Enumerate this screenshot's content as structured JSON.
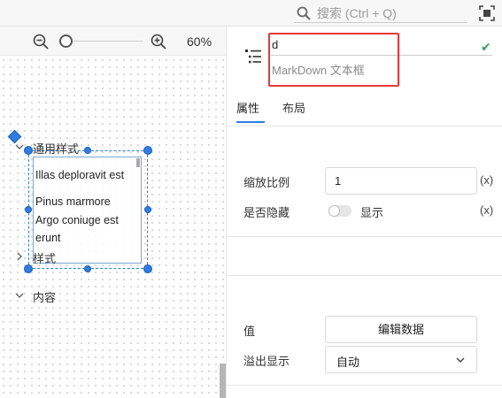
{
  "search": {
    "placeholder": "搜索 (Ctrl + Q)"
  },
  "zoom": {
    "level": "60%"
  },
  "widget": {
    "paragraphs": [
      "Illas deploravit est",
      "Pinus marmore",
      "Argo coniuge est",
      "erunt"
    ]
  },
  "component": {
    "name": "d",
    "type": "MarkDown 文本框"
  },
  "tabs": [
    {
      "label": "属性"
    },
    {
      "label": "布局"
    }
  ],
  "sections": {
    "general": {
      "title": "通用样式",
      "scale_label": "缩放比例",
      "scale_value": "1",
      "hidden_label": "是否隐藏",
      "hidden_toggle_text": "显示",
      "expr_label": "(x)"
    },
    "style": {
      "title": "样式"
    },
    "content": {
      "title": "内容",
      "value_label": "值",
      "edit_button": "编辑数据",
      "overflow_label": "溢出显示",
      "overflow_value": "自动"
    }
  },
  "colors": {
    "accent": "#2f7de1",
    "highlight": "#e53935",
    "check": "#2ea44f"
  }
}
